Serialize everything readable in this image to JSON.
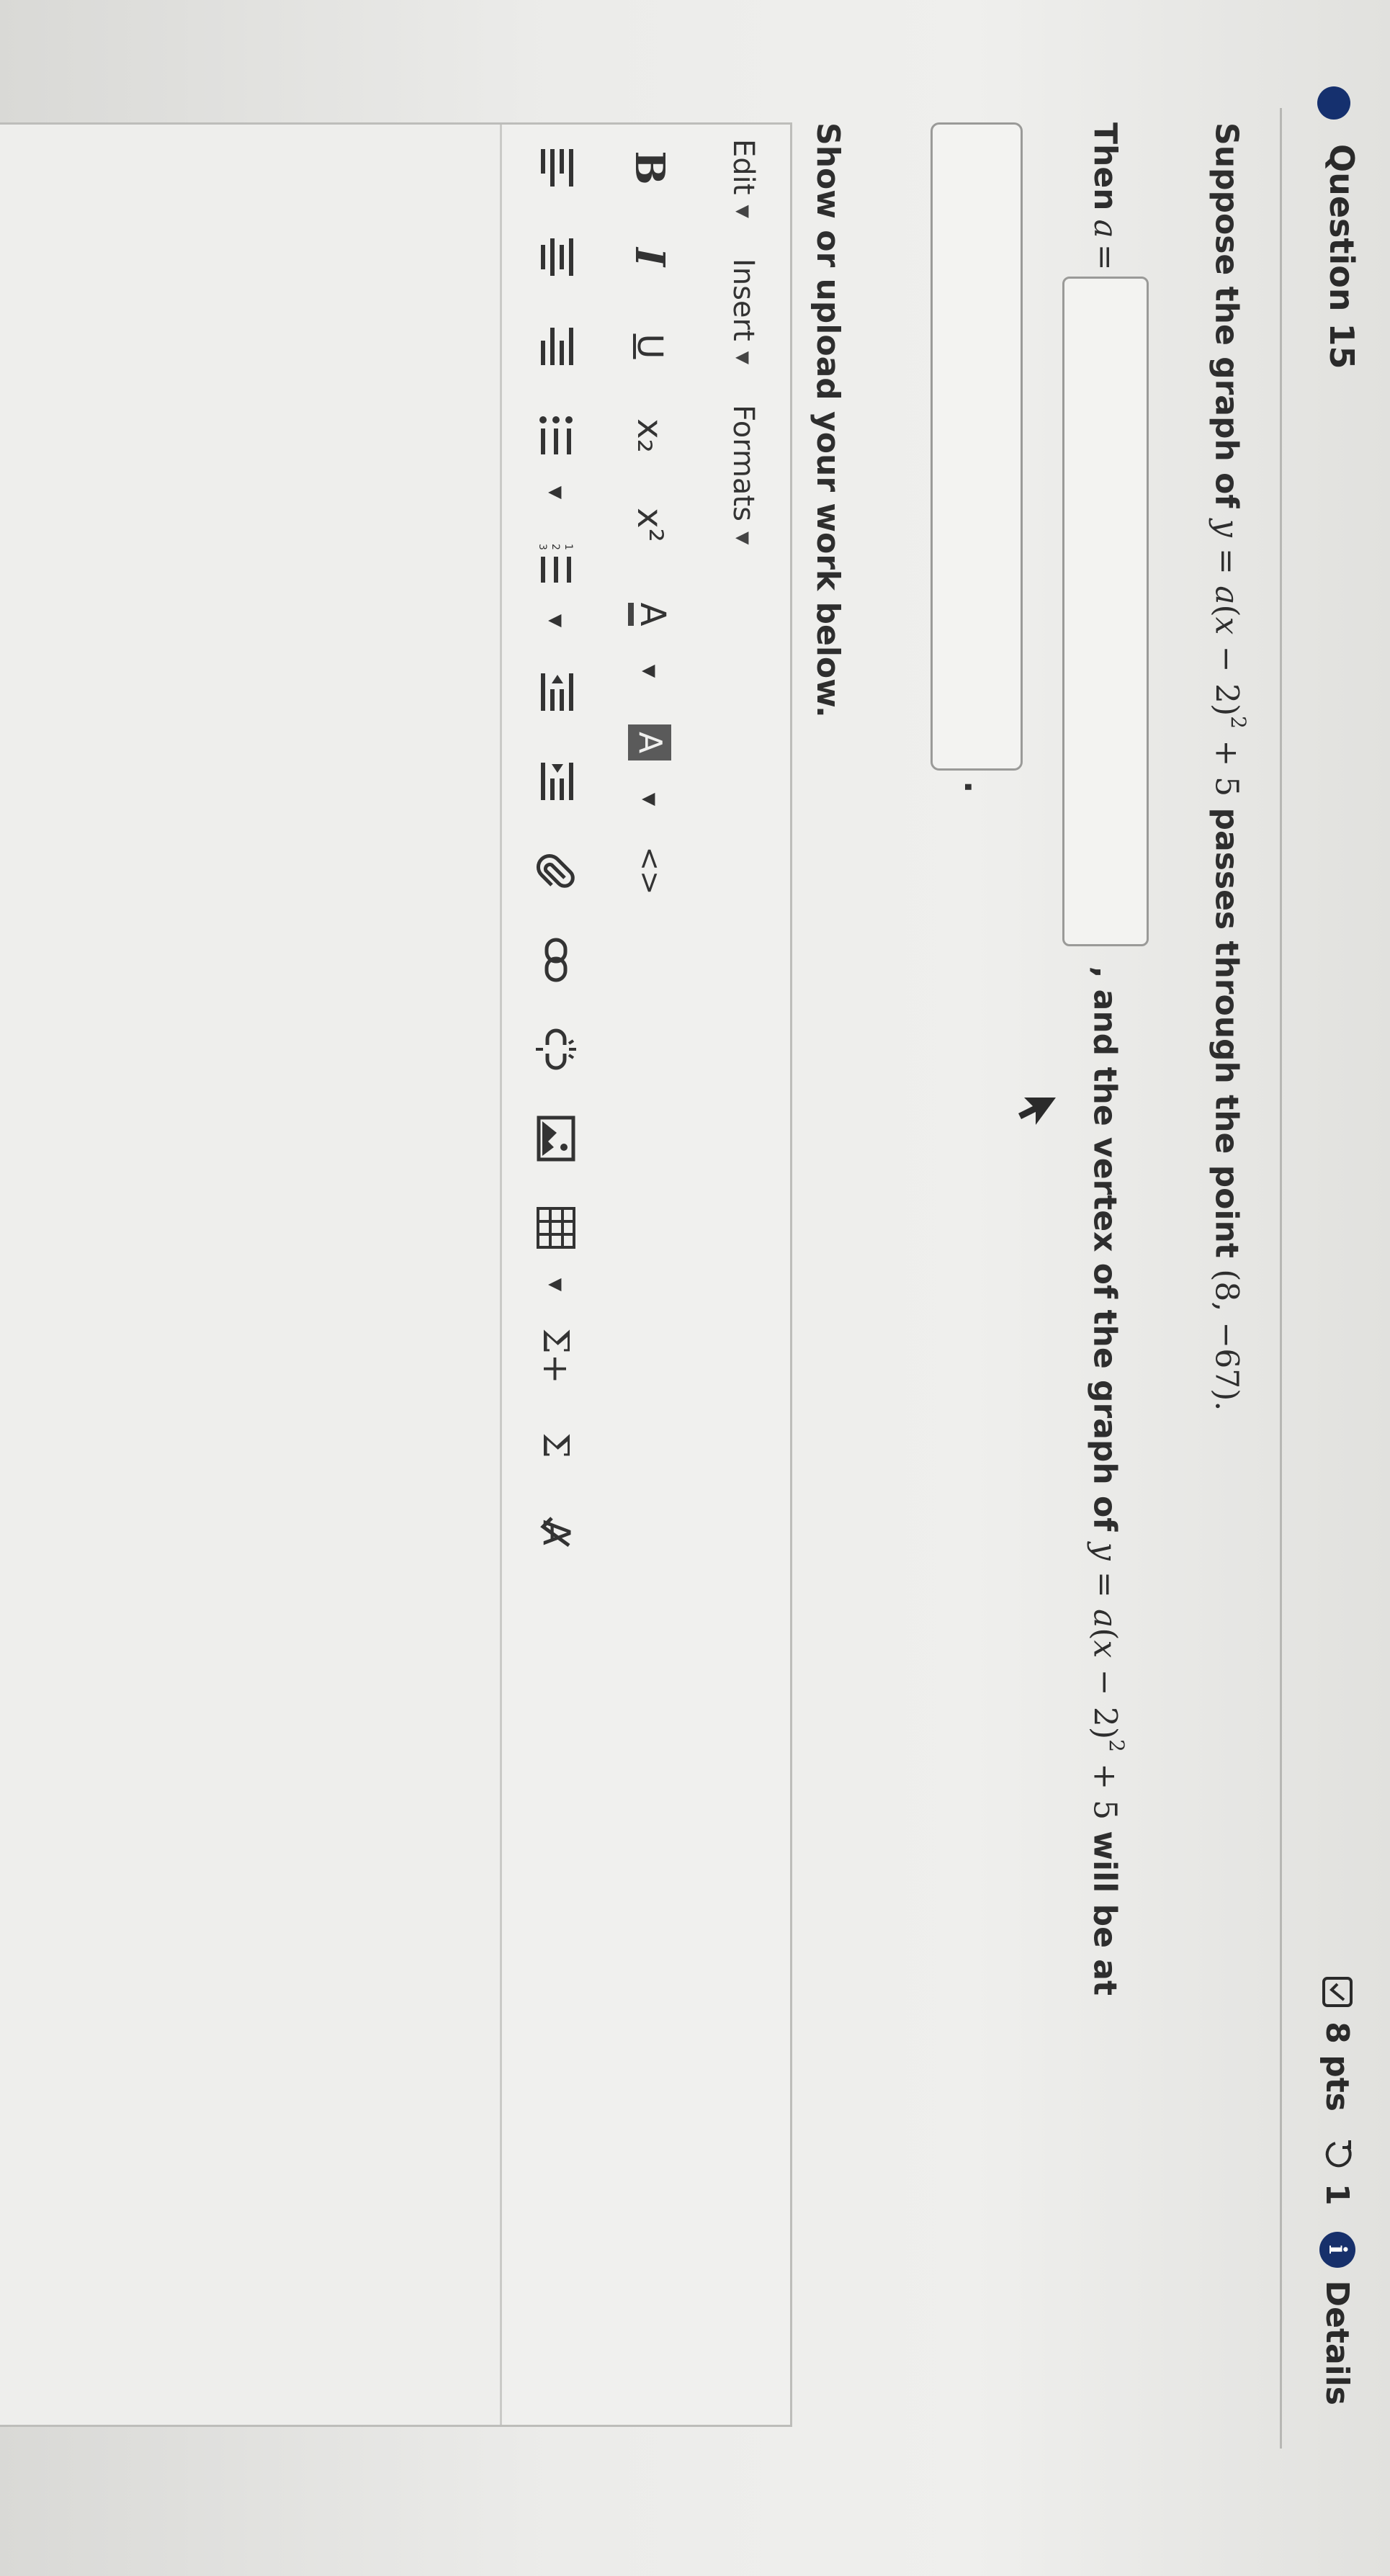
{
  "question": {
    "title": "Question 15",
    "points": "8 pts",
    "attempts": "1",
    "details_label": "Details",
    "prompt": {
      "lead": "Suppose the graph of",
      "eq_lhs": "y",
      "eq_eq": "=",
      "eq_a": "a",
      "eq_open": "(",
      "eq_x": "x",
      "eq_minus": "−",
      "eq_two": "2)",
      "eq_sup": "2",
      "eq_plus": "+ 5",
      "tail": "passes through the point",
      "point": "(8, −67)."
    },
    "then_label": "Then",
    "then_var": "a",
    "then_eq": "=",
    "a_value": "",
    "vertex_text": ", and the vertex of the graph of",
    "vertex_eq_y": "y",
    "vertex_eq_eq": "=",
    "vertex_eq_a": "a",
    "vertex_eq_open": "(",
    "vertex_eq_x": "x",
    "vertex_eq_minus": "−",
    "vertex_eq_two": "2)",
    "vertex_eq_sup": "2",
    "vertex_eq_plus": "+ 5",
    "vertex_tail": "will be at",
    "vertex_value": "",
    "vertex_period": ".",
    "upload_prompt": "Show or upload your work below."
  },
  "editor": {
    "menus": [
      {
        "label": "Edit"
      },
      {
        "label": "Insert"
      },
      {
        "label": "Formats"
      }
    ],
    "toolbar1": {
      "bold": "B",
      "italic": "I",
      "underline": "U",
      "subscript": "x₂",
      "superscript": "x²",
      "font_color": "A",
      "bg_color": "A",
      "source": "<>"
    },
    "toolbar2_icons": [
      "align-left-icon",
      "align-center-icon",
      "align-right-icon",
      "bullet-list-icon",
      "numbered-list-icon",
      "outdent-icon",
      "indent-icon",
      "attachment-icon",
      "link-icon",
      "unlink-icon",
      "image-icon",
      "table-icon",
      "insert-equation-icon",
      "sigma-icon",
      "spellcheck-icon"
    ],
    "sigma_label": "Σ",
    "sigma_plus_label": "Σ+",
    "spellcheck_label": "A"
  },
  "colors": {
    "question_dot": "#15306e",
    "info_icon": "#17306b",
    "text": "#2e2e2e"
  }
}
